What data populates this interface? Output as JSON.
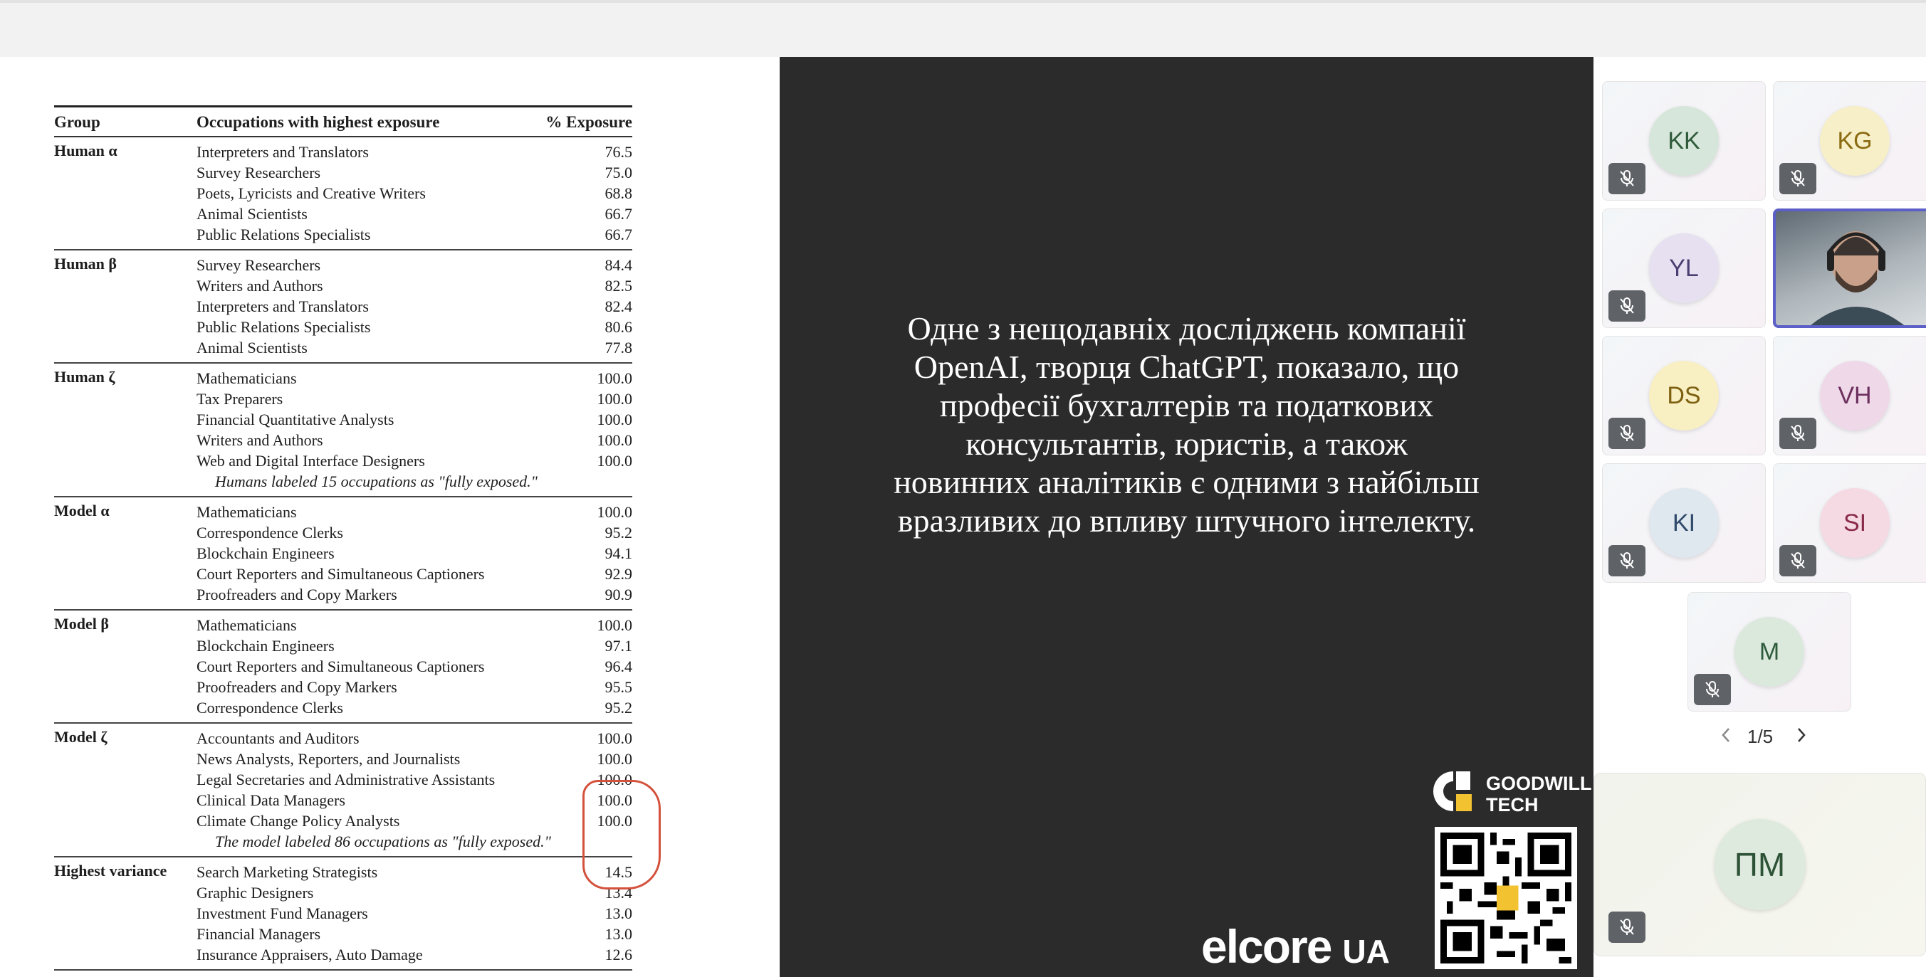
{
  "table": {
    "headers": [
      "Group",
      "Occupations with highest exposure",
      "% Exposure"
    ],
    "groups": [
      {
        "name": "Human α",
        "rows": [
          {
            "occ": "Interpreters and Translators",
            "val": "76.5"
          },
          {
            "occ": "Survey Researchers",
            "val": "75.0"
          },
          {
            "occ": "Poets, Lyricists and Creative Writers",
            "val": "68.8"
          },
          {
            "occ": "Animal Scientists",
            "val": "66.7"
          },
          {
            "occ": "Public Relations Specialists",
            "val": "66.7"
          }
        ]
      },
      {
        "name": "Human β",
        "rows": [
          {
            "occ": "Survey Researchers",
            "val": "84.4"
          },
          {
            "occ": "Writers and Authors",
            "val": "82.5"
          },
          {
            "occ": "Interpreters and Translators",
            "val": "82.4"
          },
          {
            "occ": "Public Relations Specialists",
            "val": "80.6"
          },
          {
            "occ": "Animal Scientists",
            "val": "77.8"
          }
        ]
      },
      {
        "name": "Human ζ",
        "rows": [
          {
            "occ": "Mathematicians",
            "val": "100.0"
          },
          {
            "occ": "Tax Preparers",
            "val": "100.0"
          },
          {
            "occ": "Financial Quantitative Analysts",
            "val": "100.0"
          },
          {
            "occ": "Writers and Authors",
            "val": "100.0"
          },
          {
            "occ": "Web and Digital Interface Designers",
            "val": "100.0"
          }
        ],
        "note": "Humans labeled 15 occupations as \"fully exposed.\""
      },
      {
        "name": "Model α",
        "rows": [
          {
            "occ": "Mathematicians",
            "val": "100.0"
          },
          {
            "occ": "Correspondence Clerks",
            "val": "95.2"
          },
          {
            "occ": "Blockchain Engineers",
            "val": "94.1"
          },
          {
            "occ": "Court Reporters and Simultaneous Captioners",
            "val": "92.9"
          },
          {
            "occ": "Proofreaders and Copy Markers",
            "val": "90.9"
          }
        ]
      },
      {
        "name": "Model β",
        "rows": [
          {
            "occ": "Mathematicians",
            "val": "100.0"
          },
          {
            "occ": "Blockchain Engineers",
            "val": "97.1"
          },
          {
            "occ": "Court Reporters and Simultaneous Captioners",
            "val": "96.4"
          },
          {
            "occ": "Proofreaders and Copy Markers",
            "val": "95.5"
          },
          {
            "occ": "Correspondence Clerks",
            "val": "95.2"
          }
        ]
      },
      {
        "name": "Model ζ",
        "rows": [
          {
            "occ": "Accountants and Auditors",
            "val": "100.0"
          },
          {
            "occ": "News Analysts, Reporters, and Journalists",
            "val": "100.0"
          },
          {
            "occ": "Legal Secretaries and Administrative Assistants",
            "val": "100.0"
          },
          {
            "occ": "Clinical Data Managers",
            "val": "100.0"
          },
          {
            "occ": "Climate Change Policy Analysts",
            "val": "100.0"
          }
        ],
        "note": "The model labeled 86 occupations as \"fully exposed.\""
      },
      {
        "name": "Highest variance",
        "rows": [
          {
            "occ": "Search Marketing Strategists",
            "val": "14.5"
          },
          {
            "occ": "Graphic Designers",
            "val": "13.4"
          },
          {
            "occ": "Investment Fund Managers",
            "val": "13.0"
          },
          {
            "occ": "Financial Managers",
            "val": "13.0"
          },
          {
            "occ": "Insurance Appraisers, Auto Damage",
            "val": "12.6"
          }
        ]
      }
    ]
  },
  "slide": {
    "lines": [
      "Одне з нещодавніх досліджень компанії",
      "OpenAI, творця ChatGPT, показало, що",
      "професії бухгалтерів та податкових",
      "консультантів, юристів, а також",
      "новинних аналітиків є одними з найбільш",
      "вразливих до впливу штучного інтелекту."
    ],
    "brand_line1": "GOODWILL",
    "brand_line2": "TECH",
    "sponsor": "elcore",
    "sponsor_suffix": "UA"
  },
  "participants": [
    {
      "initials": "KK",
      "bg": "#d7e6da",
      "color": "#2e5a3a"
    },
    {
      "initials": "KG",
      "bg": "#f7efc8",
      "color": "#8a6b12"
    },
    {
      "initials": "YL",
      "bg": "#e6e0f1",
      "color": "#4b3e70"
    },
    {
      "initials": "",
      "video": true
    },
    {
      "initials": "DS",
      "bg": "#f8efc3",
      "color": "#7c5f0f"
    },
    {
      "initials": "VH",
      "bg": "#efd9e9",
      "color": "#6d2f5e"
    },
    {
      "initials": "KI",
      "bg": "#dfe7ef",
      "color": "#2f4a6a"
    },
    {
      "initials": "SI",
      "bg": "#f5d9e3",
      "color": "#8a2a4a"
    },
    {
      "initials": "M",
      "bg": "#dbe9dd",
      "color": "#2e5a3a"
    }
  ],
  "pager": {
    "label": "1/5"
  },
  "active_speaker": {
    "initials": "ПМ",
    "bg": "#dfeadf",
    "color": "#2d5236"
  },
  "colors": {
    "annotation": "#d4513c",
    "slide_bg": "#2b2b2b",
    "active_border": "#5b5fc7"
  }
}
